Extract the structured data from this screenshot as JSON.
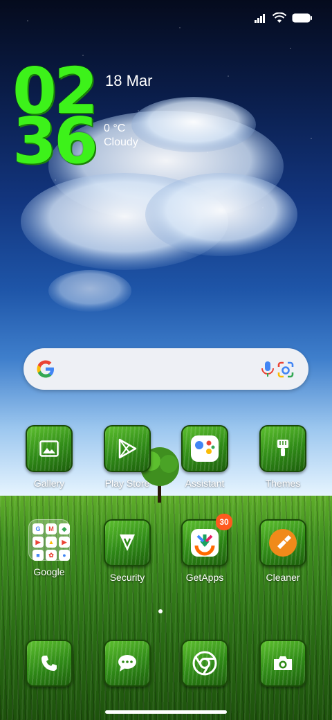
{
  "status_bar": {
    "icons": [
      "signal-icon",
      "wifi-icon",
      "battery-icon"
    ]
  },
  "clock": {
    "hour": "02",
    "minute": "36"
  },
  "date": "18 Mar",
  "weather": {
    "temperature": "0 °C",
    "condition": "Cloudy"
  },
  "search": {
    "icons": [
      "google-logo-icon",
      "mic-icon",
      "google-lens-icon"
    ]
  },
  "apps_row1": [
    {
      "label": "Gallery",
      "icon": "gallery-icon"
    },
    {
      "label": "Play Store",
      "icon": "play-store-icon"
    },
    {
      "label": "Assistant",
      "icon": "assistant-icon"
    },
    {
      "label": "Themes",
      "icon": "themes-brush-icon"
    }
  ],
  "apps_row2": [
    {
      "label": "Google",
      "icon": "google-folder-icon"
    },
    {
      "label": "Security",
      "icon": "security-icon"
    },
    {
      "label": "GetApps",
      "icon": "getapps-icon",
      "badge": "30"
    },
    {
      "label": "Cleaner",
      "icon": "cleaner-brush-icon"
    }
  ],
  "dock": [
    {
      "icon": "phone-icon"
    },
    {
      "icon": "messages-icon"
    },
    {
      "icon": "chrome-icon"
    },
    {
      "icon": "camera-icon"
    }
  ],
  "colors": {
    "clock": "#3df21a",
    "badge": "#ff5a1f",
    "search_bg": "#eef0f5"
  }
}
